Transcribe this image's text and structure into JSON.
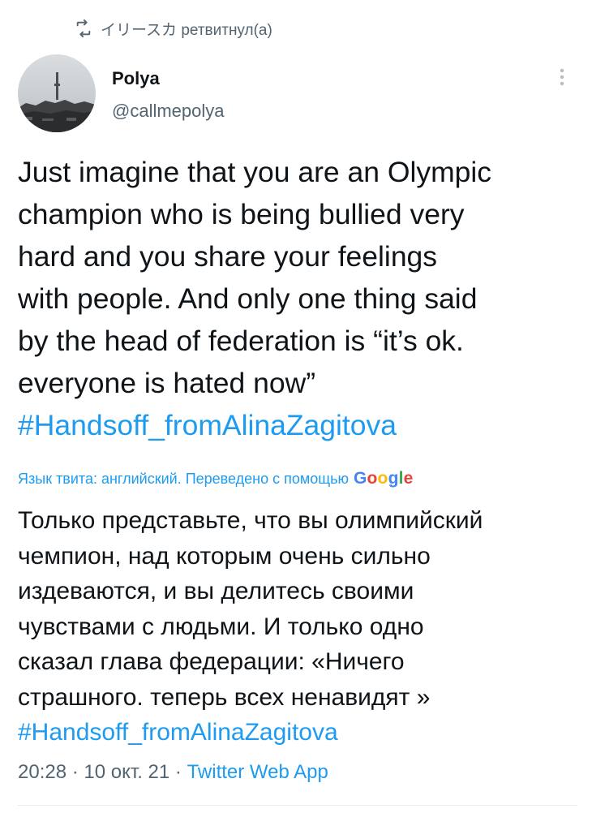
{
  "retweet": {
    "text": "イリースカ ретвитнул(а)"
  },
  "author": {
    "name": "Polya",
    "handle": "@callmepolya"
  },
  "tweet": {
    "line1": "Just imagine that you are an Olympic",
    "line2": "champion who is being bullied very",
    "line3": "hard and you share your feelings",
    "line4": "with people. And only one thing said",
    "line5": "by the head of federation is “it’s ok.",
    "line6": "everyone is hated now”",
    "hashtag": "#Handsoff_fromAlinaZagitova"
  },
  "translation": {
    "label": "Язык твита: английский. Переведено с помощью",
    "google": [
      "G",
      "o",
      "o",
      "g",
      "l",
      "e"
    ],
    "line1": "Только представьте, что вы олимпийский",
    "line2": "чемпион, над которым очень сильно",
    "line3": "издеваются, и вы делитесь своими",
    "line4": "чувствами с людьми. И только одно",
    "line5": "сказал глава федерации: «Ничего",
    "line6": "страшного. теперь всех ненавидят »",
    "hashtag": "#Handsoff_fromAlinaZagitova"
  },
  "meta": {
    "time": "20:28",
    "sep1": " · ",
    "date": "10 окт. 21",
    "sep2": " · ",
    "source": "Twitter Web App"
  },
  "colors": {
    "link": "#1d9bf0",
    "muted": "#536471",
    "text": "#0f1419",
    "google": [
      "#4285F4",
      "#EA4335",
      "#FBBC05",
      "#4285F4",
      "#34A853",
      "#EA4335"
    ]
  },
  "icons": {
    "retweet": "retweet-icon",
    "more": "more-dots-icon"
  }
}
